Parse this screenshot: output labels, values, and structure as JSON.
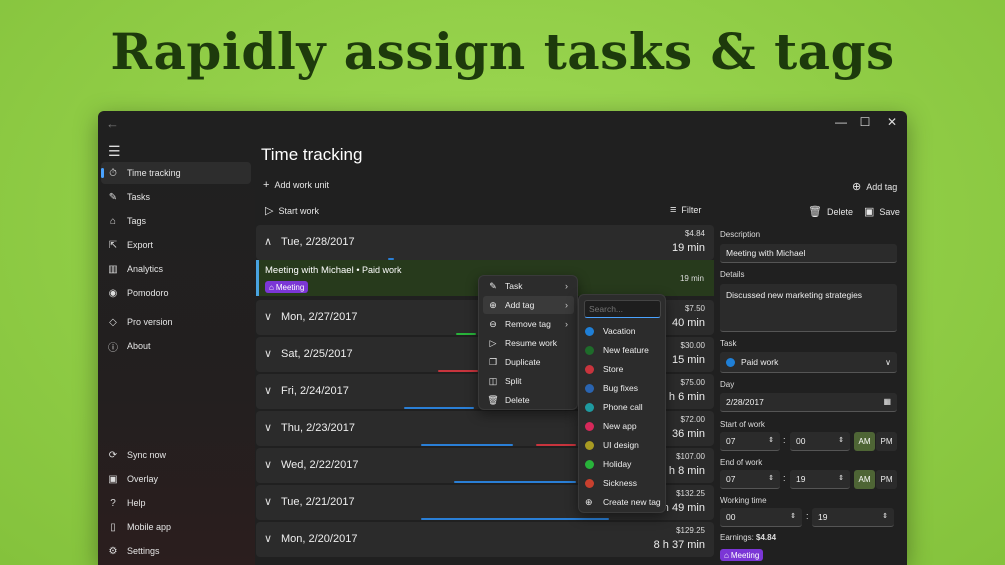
{
  "headline": "Rapidly assign tasks & tags",
  "colors": {
    "accent": "#4aa3ff",
    "brand_bg": "#8fcc45",
    "tag_purple": "#7b36d6",
    "ampm_on": "#4e6535"
  },
  "window": {
    "controls": {
      "back": "←",
      "minimize": "—",
      "maximize": "☐",
      "close": "✕"
    }
  },
  "sidebar": {
    "items": [
      {
        "label": "Time tracking",
        "icon": "stopwatch-icon",
        "glyph": "⏱"
      },
      {
        "label": "Tasks",
        "icon": "wrench-icon",
        "glyph": "✎"
      },
      {
        "label": "Tags",
        "icon": "tag-icon",
        "glyph": "⌂"
      },
      {
        "label": "Export",
        "icon": "export-icon",
        "glyph": "⇱"
      },
      {
        "label": "Analytics",
        "icon": "chart-icon",
        "glyph": "▥"
      },
      {
        "label": "Pomodoro",
        "icon": "tomato-icon",
        "glyph": "◉"
      },
      {
        "label": "Pro version",
        "icon": "diamond-icon",
        "glyph": "◇"
      },
      {
        "label": "About",
        "icon": "info-icon",
        "glyph": "ⓘ"
      }
    ],
    "bottom_items": [
      {
        "label": "Sync now",
        "icon": "sync-icon",
        "glyph": "⟳"
      },
      {
        "label": "Overlay",
        "icon": "overlay-icon",
        "glyph": "▣"
      },
      {
        "label": "Help",
        "icon": "help-icon",
        "glyph": "?"
      },
      {
        "label": "Mobile app",
        "icon": "phone-icon",
        "glyph": "▯"
      },
      {
        "label": "Settings",
        "icon": "gear-icon",
        "glyph": "⚙"
      }
    ]
  },
  "main": {
    "title": "Time tracking",
    "add_work_unit": "Add work unit",
    "start_work": "Start work",
    "filter": "Filter",
    "add_tag": "Add tag",
    "delete": "Delete",
    "save": "Save",
    "days": [
      {
        "date": "Tue, 2/28/2017",
        "amount": "$4.84",
        "duration": "19 min",
        "expanded": true
      },
      {
        "date": "Mon, 2/27/2017",
        "amount": "$7.50",
        "duration": "40 min"
      },
      {
        "date": "Sat, 2/25/2017",
        "amount": "$30.00",
        "duration": "15 min"
      },
      {
        "date": "Fri, 2/24/2017",
        "amount": "$75.00",
        "duration": "h 6 min"
      },
      {
        "date": "Thu, 2/23/2017",
        "amount": "$72.00",
        "duration": "36 min"
      },
      {
        "date": "Wed, 2/22/2017",
        "amount": "$107.00",
        "duration": "h 8 min"
      },
      {
        "date": "Tue, 2/21/2017",
        "amount": "$132.25",
        "duration": "h 49 min"
      },
      {
        "date": "Mon, 2/20/2017",
        "amount": "$129.25",
        "duration": "8 h 37 min"
      }
    ],
    "entry": {
      "title": "Meeting with Michael",
      "task": "• Paid work",
      "duration": "19 min",
      "tag": "Meeting"
    }
  },
  "context_menu": {
    "items": [
      {
        "label": "Task",
        "glyph": "✎",
        "icon": "wrench-icon",
        "submenu": true
      },
      {
        "label": "Add tag",
        "glyph": "⊕",
        "icon": "add-tag-icon",
        "submenu": true
      },
      {
        "label": "Remove tag",
        "glyph": "⊖",
        "icon": "remove-tag-icon",
        "submenu": true
      },
      {
        "label": "Resume work",
        "glyph": "▷",
        "icon": "play-icon",
        "submenu": false
      },
      {
        "label": "Duplicate",
        "glyph": "❐",
        "icon": "duplicate-icon",
        "submenu": false
      },
      {
        "label": "Split",
        "glyph": "◫",
        "icon": "split-icon",
        "submenu": false
      },
      {
        "label": "Delete",
        "glyph": "🗑",
        "icon": "trash-icon",
        "submenu": false
      }
    ]
  },
  "tag_menu": {
    "search_placeholder": "Search...",
    "tags": [
      {
        "label": "Vacation",
        "color": "#1f7fd6"
      },
      {
        "label": "New feature",
        "color": "#1e6b2a"
      },
      {
        "label": "Store",
        "color": "#c8343d"
      },
      {
        "label": "Bug fixes",
        "color": "#2a64b0"
      },
      {
        "label": "Phone call",
        "color": "#1e9aa0"
      },
      {
        "label": "New app",
        "color": "#d6285a"
      },
      {
        "label": "UI design",
        "color": "#a89a22"
      },
      {
        "label": "Holiday",
        "color": "#28b33a"
      },
      {
        "label": "Sickness",
        "color": "#c8402e"
      }
    ],
    "create": "Create new tag"
  },
  "details": {
    "description_label": "Description",
    "description": "Meeting with Michael",
    "details_label": "Details",
    "details": "Discussed new marketing strategies",
    "task_label": "Task",
    "task": "Paid work",
    "task_color": "#1f7fd6",
    "day_label": "Day",
    "day": "2/28/2017",
    "start_label": "Start of work",
    "start_h": "07",
    "start_m": "00",
    "end_label": "End of work",
    "end_h": "07",
    "end_m": "19",
    "am": "AM",
    "pm": "PM",
    "working_label": "Working time",
    "working_h": "00",
    "working_m": "19",
    "earnings_label": "Earnings:",
    "earnings": "$4.84",
    "tag": "Meeting"
  }
}
